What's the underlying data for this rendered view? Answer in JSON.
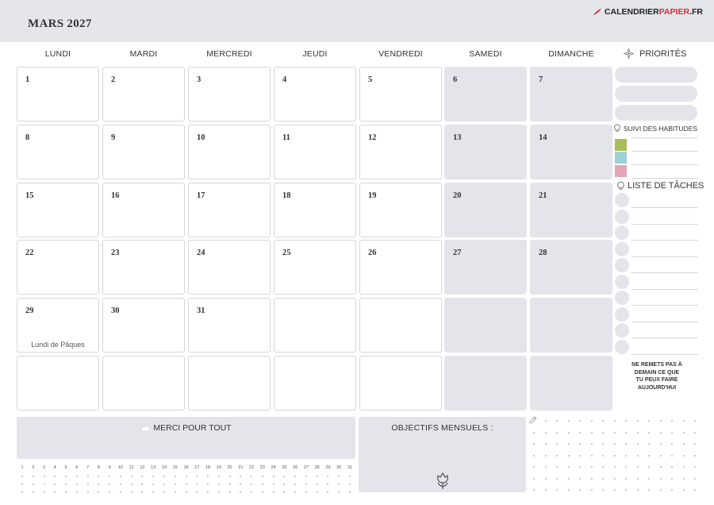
{
  "header": {
    "title": "MARS 2027",
    "brand_prefix": "CALENDRIER",
    "brand_accent": "PAPIER",
    "brand_suffix": ".FR",
    "brand_color": "#c8323c"
  },
  "weekdays": [
    "LUNDI",
    "MARDI",
    "MERCREDI",
    "JEUDI",
    "VENDREDI",
    "SAMEDI",
    "DIMANCHE"
  ],
  "weeks": [
    [
      "1",
      "2",
      "3",
      "4",
      "5",
      "6",
      "7"
    ],
    [
      "8",
      "9",
      "10",
      "11",
      "12",
      "13",
      "14"
    ],
    [
      "15",
      "16",
      "17",
      "18",
      "19",
      "20",
      "21"
    ],
    [
      "22",
      "23",
      "24",
      "25",
      "26",
      "27",
      "28"
    ],
    [
      "29",
      "30",
      "31",
      "",
      "",
      "",
      ""
    ],
    [
      "",
      "",
      "",
      "",
      "",
      "",
      ""
    ]
  ],
  "holiday": {
    "label": "Lundi de Pâques",
    "day": "29"
  },
  "sidebar": {
    "priorities_label": "PRIORITÉS",
    "habits_label": "SUIVI DES HABITUDES",
    "habit_colors": [
      "#a9bd5a",
      "#9fcfd8",
      "#e2a6b4"
    ],
    "tasks_label": "LISTE DE TÂCHES",
    "quote": [
      "NE REMETS PAS À",
      "DEMAIN CE QUE",
      "TU PEUX FAIRE",
      "AUJOURD'HUI"
    ]
  },
  "footer": {
    "thanks_label": "MERCI POUR TOUT",
    "goals_label": "OBJECTIFS MENSUELS :",
    "day_numbers": [
      "1",
      "2",
      "3",
      "4",
      "5",
      "6",
      "7",
      "8",
      "9",
      "10",
      "11",
      "12",
      "13",
      "14",
      "15",
      "16",
      "17",
      "18",
      "19",
      "20",
      "21",
      "22",
      "23",
      "24",
      "25",
      "26",
      "27",
      "28",
      "29",
      "30",
      "31"
    ]
  },
  "colors": {
    "weekend_fill": "#e4e5ea",
    "header_fill": "#e5e6eb"
  }
}
